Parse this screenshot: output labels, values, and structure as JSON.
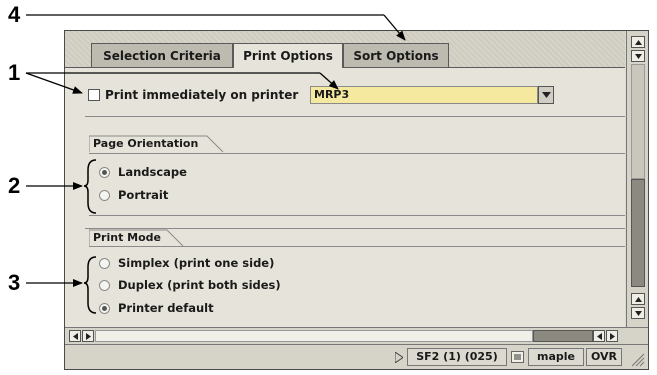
{
  "callouts": [
    "1",
    "2",
    "3",
    "4"
  ],
  "tabs": [
    {
      "label": "Selection Criteria",
      "active": false
    },
    {
      "label": "Print Options",
      "active": true
    },
    {
      "label": "Sort Options",
      "active": false
    }
  ],
  "print_immediately": {
    "label": "Print immediately on printer",
    "checked": false
  },
  "printer": {
    "value": "MRP3"
  },
  "page_orientation": {
    "title": "Page Orientation",
    "options": [
      {
        "label": "Landscape",
        "selected": true
      },
      {
        "label": "Portrait",
        "selected": false
      }
    ]
  },
  "print_mode": {
    "title": "Print Mode",
    "options": [
      {
        "label": "Simplex (print one side)",
        "selected": false
      },
      {
        "label": "Duplex (print both sides)",
        "selected": false
      },
      {
        "label": "Printer default",
        "selected": true
      }
    ]
  },
  "status": {
    "session": "SF2 (1) (025)",
    "host": "maple",
    "mode": "OVR"
  },
  "colors": {
    "field_bg": "#f5e9a0",
    "panel_bg": "#e6e4da",
    "tab_bg": "#bdbbb0"
  }
}
